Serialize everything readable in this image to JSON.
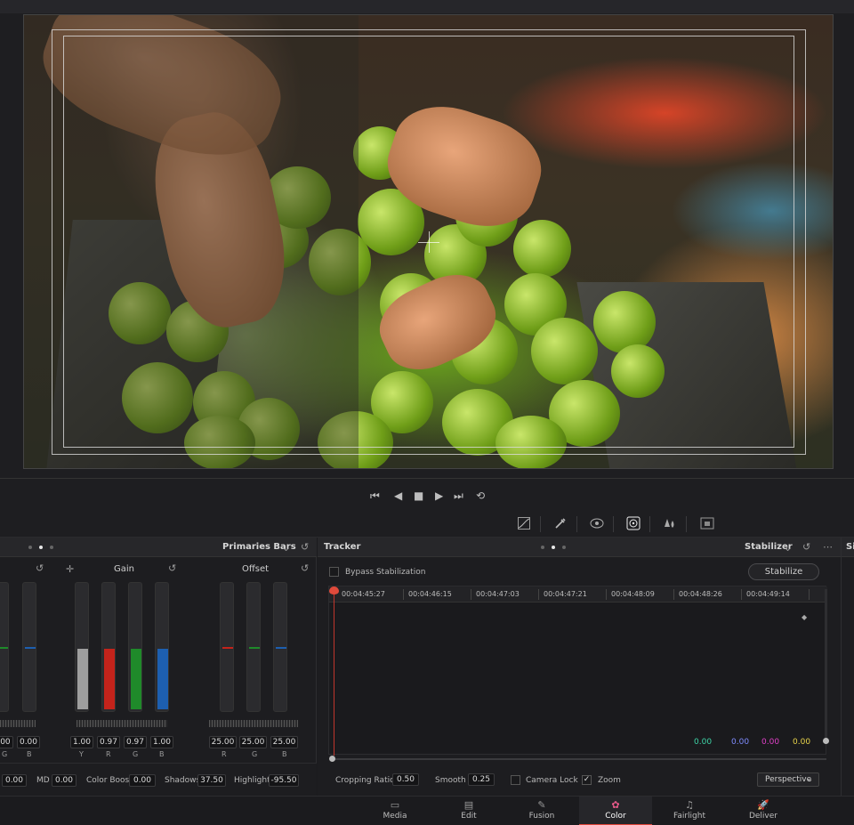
{
  "transport": {
    "first_icon": "⏮",
    "prev_icon": "◀",
    "stop_icon": "■",
    "play_icon": "▶",
    "last_icon": "⏭",
    "loop_icon": "⟲"
  },
  "tools": {
    "curves_icon": "curves-icon",
    "picker_icon": "eyedropper-icon",
    "window_icon": "window-icon",
    "tracker_icon": "tracker-icon",
    "blur_icon": "blur-icon",
    "key_icon": "key-icon"
  },
  "primaries": {
    "mode_label": "Primaries Bars",
    "gain": {
      "title": "Gain",
      "values": [
        "1.00",
        "0.97",
        "0.97",
        "1.00"
      ],
      "channels": [
        "Y",
        "R",
        "G",
        "B"
      ],
      "fills": [
        0.5,
        0.5,
        0.5,
        0.5
      ]
    },
    "offset": {
      "title": "Offset",
      "values": [
        "25.00",
        "25.00",
        "25.00"
      ],
      "channels": [
        "R",
        "G",
        "B"
      ]
    },
    "partial": {
      "values": [
        ".00",
        "0.00"
      ],
      "channels": [
        "G",
        "B"
      ]
    },
    "params": {
      "first_value": "0.00",
      "md_label": "MD",
      "md_value": "0.00",
      "color_boost_label": "Color Boost",
      "color_boost_value": "0.00",
      "shadows_label": "Shadows",
      "shadows_value": "37.50",
      "highlights_label": "Highlights",
      "highlights_value": "-95.50"
    }
  },
  "tracker": {
    "title": "Tracker",
    "mode_label": "Stabilizer",
    "bypass_label": "Bypass Stabilization",
    "stabilize_label": "Stabilize",
    "timecodes": [
      "00:04:45:27",
      "00:04:46:15",
      "00:04:47:03",
      "00:04:47:21",
      "00:04:48:09",
      "00:04:48:26",
      "00:04:49:14"
    ],
    "levels": [
      {
        "value": "0.00",
        "color": "#3ed6a8"
      },
      {
        "value": "0.00",
        "color": "#7f8cff"
      },
      {
        "value": "0.00",
        "color": "#e040c8"
      },
      {
        "value": "0.00",
        "color": "#e8d44a"
      }
    ],
    "cropping_ratio_label": "Cropping Ratio",
    "cropping_ratio_value": "0.50",
    "smooth_label": "Smooth",
    "smooth_value": "0.25",
    "camera_lock_label": "Camera Lock",
    "zoom_label": "Zoom",
    "zoom_checked": "✓",
    "perspective_label": "Perspective"
  },
  "right_panel_label": "Si",
  "pages": [
    {
      "label": "Media",
      "icon": "▭"
    },
    {
      "label": "Edit",
      "icon": "▤"
    },
    {
      "label": "Fusion",
      "icon": "✎"
    },
    {
      "label": "Color",
      "icon": "✿"
    },
    {
      "label": "Fairlight",
      "icon": "♫"
    },
    {
      "label": "Deliver",
      "icon": "🚀"
    }
  ],
  "colors": {
    "accent": "#e0463a",
    "gain_y": "#9e9e9e",
    "gain_r": "#c4231b",
    "gain_g": "#1f8a2a",
    "gain_b": "#1d5fb0"
  }
}
